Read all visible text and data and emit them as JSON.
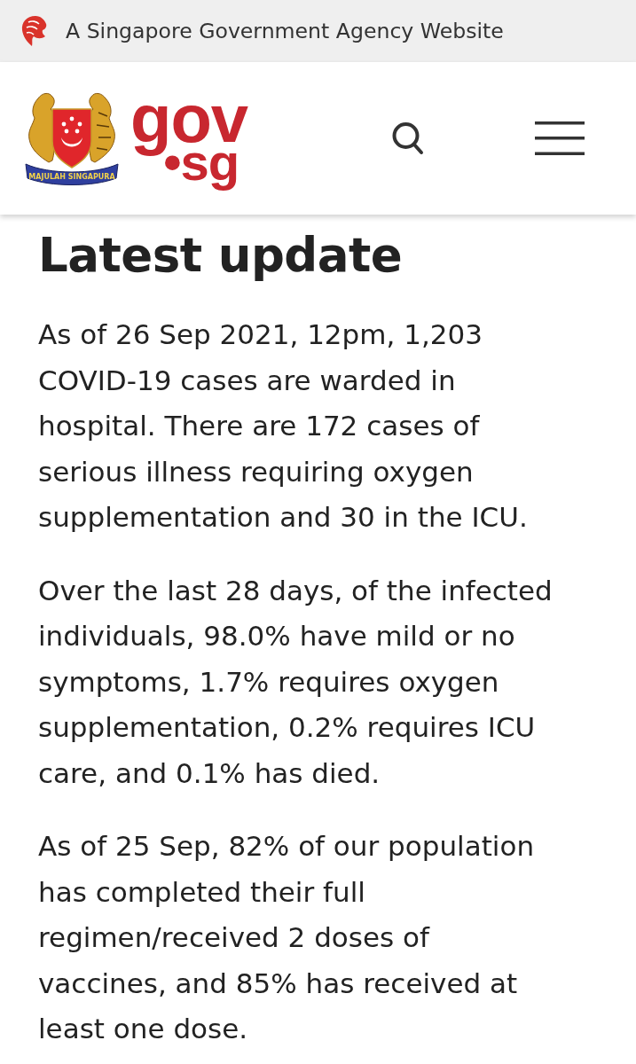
{
  "masthead": {
    "text": "A Singapore Government Agency Website"
  },
  "header": {
    "emblem_motto": "MAJULAH SINGAPURA",
    "logo": [
      "gov",
      "•sg"
    ]
  },
  "article": {
    "heading": "Latest update",
    "paragraphs": [
      "As of 26 Sep 2021, 12pm, 1,203 COVID-19 cases are warded in hospital. There are 172 cases of serious illness requiring oxygen supplementation and 30 in the ICU.",
      "Over the last 28 days, of the infected individuals, 98.0% have mild or no symptoms, 1.7% requires oxygen supplementation, 0.2% requires ICU care, and 0.1% has died.",
      "As of 25 Sep, 82% of our population has completed their full regimen/received 2 doses of vaccines, and 85% has received at least one dose."
    ]
  }
}
